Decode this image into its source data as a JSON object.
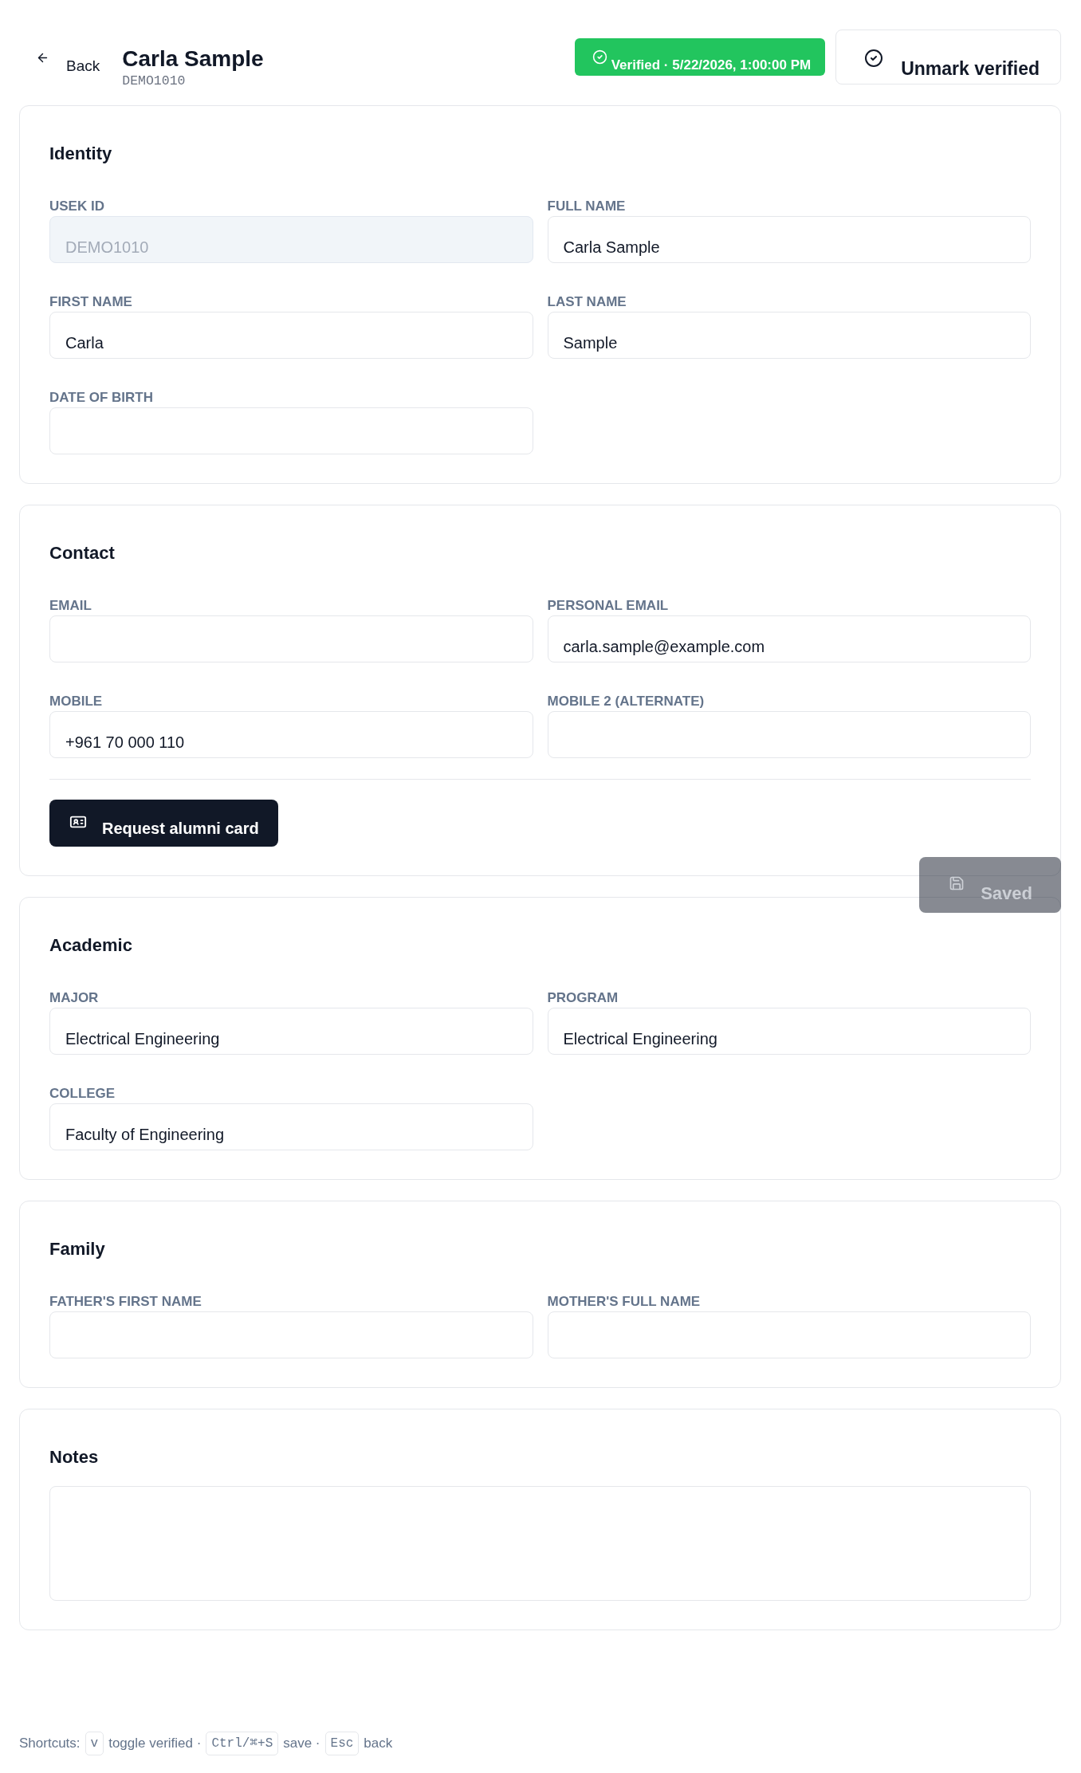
{
  "header": {
    "back_button": "Back",
    "title": "Carla Sample",
    "record_id": "DEMO1010",
    "verification": {
      "verified": true,
      "badge": "Verified · 5/22/2026, 1:00:00 PM",
      "toggle_button": "Unmark verified"
    }
  },
  "sections": [
    {
      "kind": "form",
      "title": "Identity",
      "fields": [
        {
          "label": "USEK ID",
          "value": "DEMO1010",
          "disabled": true
        },
        {
          "label": "FULL NAME",
          "value": "Carla Sample",
          "disabled": false
        },
        {
          "label": "FIRST NAME",
          "value": "Carla",
          "disabled": false
        },
        {
          "label": "LAST NAME",
          "value": "Sample",
          "disabled": false
        },
        {
          "label": "DATE OF BIRTH",
          "disabled": false
        }
      ]
    },
    {
      "kind": "form",
      "title": "Contact",
      "fields": [
        {
          "label": "EMAIL",
          "disabled": false
        },
        {
          "label": "PERSONAL EMAIL",
          "value": "carla.sample@example.com",
          "disabled": false
        },
        {
          "label": "MOBILE",
          "value": "+961 70 000 110",
          "disabled": false
        },
        {
          "label": "MOBILE 2 (ALTERNATE)",
          "disabled": false
        }
      ],
      "action_button": "Request alumni card"
    },
    {
      "kind": "form",
      "title": "Academic",
      "fields": [
        {
          "label": "MAJOR",
          "value": "Electrical Engineering",
          "disabled": false
        },
        {
          "label": "PROGRAM",
          "value": "Electrical Engineering",
          "disabled": false
        },
        {
          "label": "COLLEGE",
          "value": "Faculty of Engineering",
          "disabled": false
        }
      ]
    },
    {
      "kind": "form",
      "title": "Family",
      "fields": [
        {
          "label": "FATHER'S FIRST NAME",
          "disabled": false
        },
        {
          "label": "MOTHER'S FULL NAME",
          "disabled": false
        }
      ]
    },
    {
      "kind": "notes",
      "title": "Notes"
    }
  ],
  "save_button": {
    "label": "Saved",
    "disabled": true
  },
  "shortcuts": {
    "label": "Shortcuts:",
    "items": [
      {
        "key": "v",
        "action": "toggle verified ·"
      },
      {
        "key": "Ctrl/⌘+S",
        "action": "save ·"
      },
      {
        "key": "Esc",
        "action": "back"
      }
    ]
  }
}
